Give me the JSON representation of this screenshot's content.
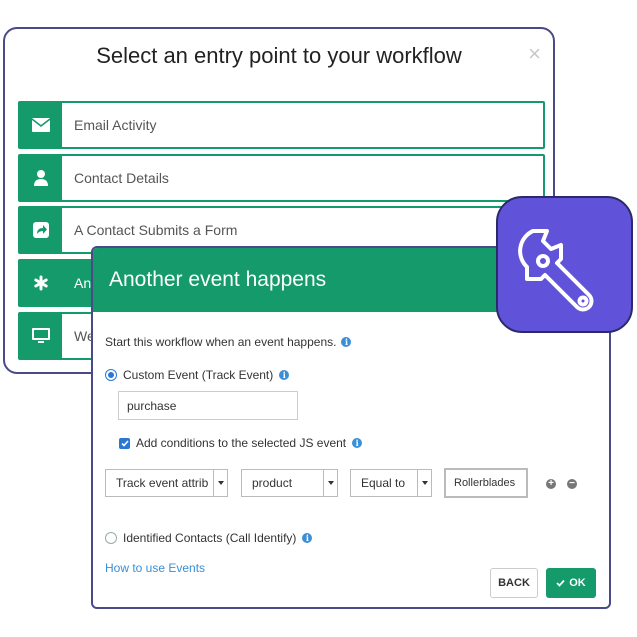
{
  "back_dialog": {
    "title": "Select an entry point to your workflow",
    "close_glyph": "×",
    "entries": [
      {
        "label": "Email Activity",
        "icon": "envelope-icon"
      },
      {
        "label": "Contact Details",
        "icon": "person-icon"
      },
      {
        "label": "A Contact Submits a Form",
        "icon": "share-arrow-icon"
      },
      {
        "label": "An",
        "icon": "asterisk-icon"
      },
      {
        "label": "We",
        "icon": "monitor-icon"
      }
    ]
  },
  "front_dialog": {
    "title": "Another event happens",
    "intro": "Start this workflow when an event happens.",
    "custom_event_label": "Custom Event (Track Event)",
    "event_input_value": "purchase",
    "add_conditions_label": "Add conditions to the selected JS event",
    "condition": {
      "attribute": "Track event attrib",
      "property": "product",
      "operator": "Equal to",
      "value": "Rollerblades"
    },
    "identified_label": "Identified Contacts (Call Identify)",
    "help_link": "How to use Events",
    "back_label": "BACK",
    "ok_label": "OK"
  },
  "colors": {
    "accent_green": "#159a6c",
    "badge_purple": "#6153d9",
    "link_blue": "#3a8fd6",
    "outline": "#4a4a8a"
  }
}
